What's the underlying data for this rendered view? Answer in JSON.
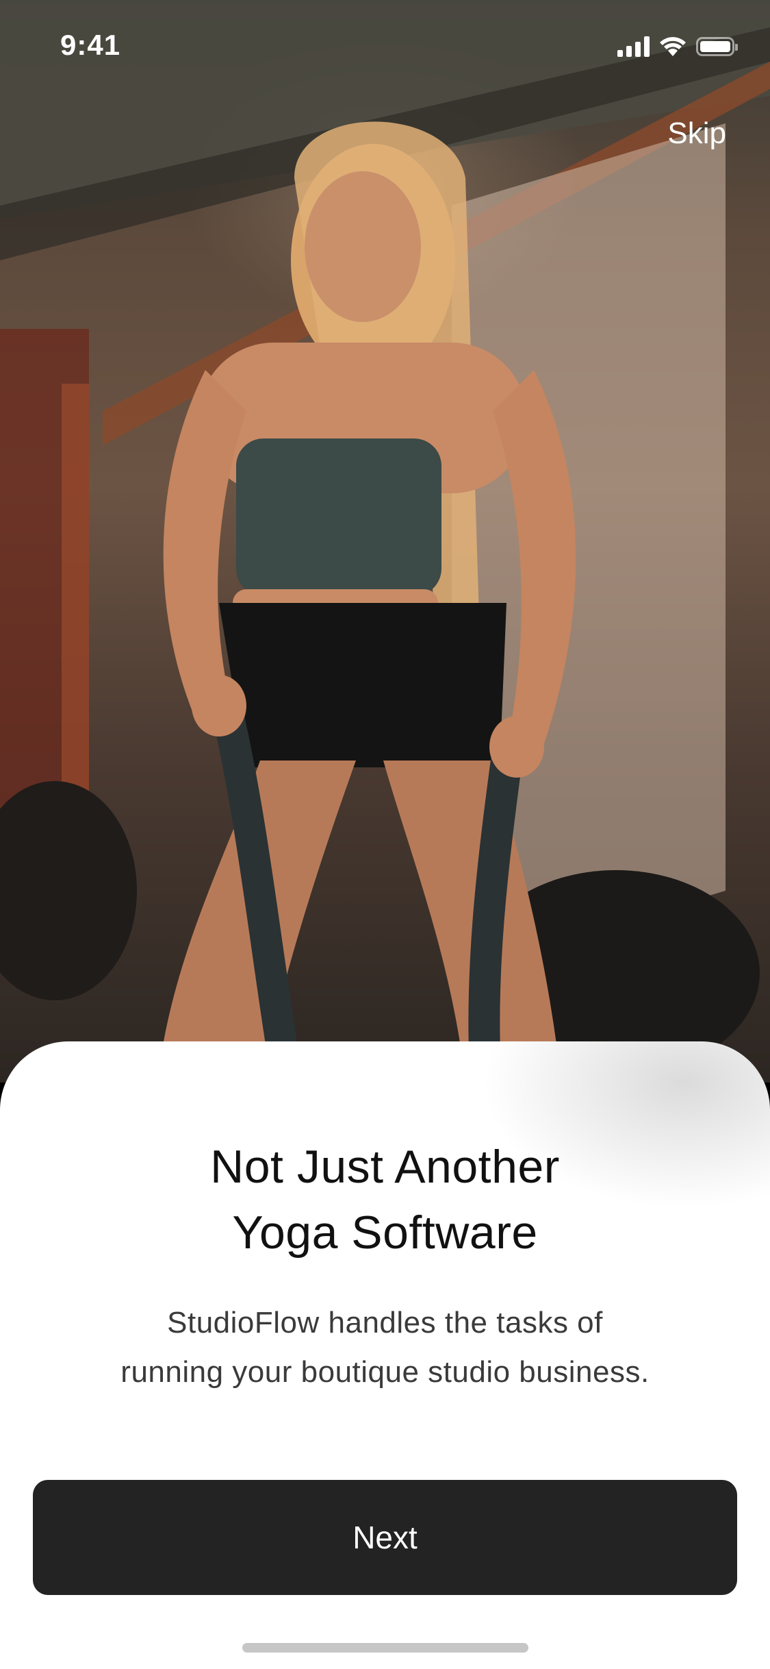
{
  "status_bar": {
    "time": "9:41",
    "icons": [
      "cellular-signal-icon",
      "wifi-icon",
      "battery-icon"
    ]
  },
  "header": {
    "skip_label": "Skip"
  },
  "hero": {
    "image_subject": "woman doing battle rope exercise in gym"
  },
  "onboarding": {
    "title_lines": [
      "Not Just Another",
      "Yoga Software"
    ],
    "subtitle_lines": [
      "StudioFlow handles the tasks of",
      "running your boutique studio business."
    ],
    "next_label": "Next"
  },
  "colors": {
    "button_background": "#232323",
    "button_text": "#ffffff",
    "sheet_background": "#ffffff",
    "title_text": "#111111",
    "subtitle_text": "#3a3a3a",
    "home_indicator": "#c6c6c6"
  }
}
